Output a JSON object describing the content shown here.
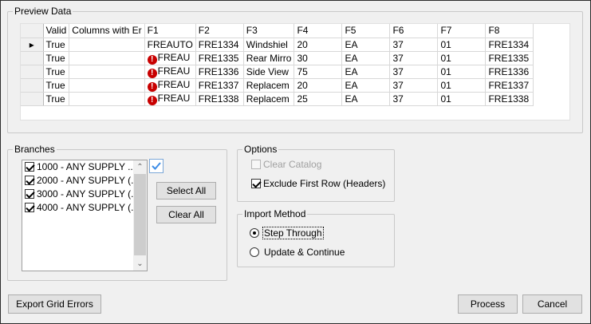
{
  "preview": {
    "legend": "Preview Data",
    "columns": [
      "Valid",
      "Columns with Er",
      "F1",
      "F2",
      "F3",
      "F4",
      "F5",
      "F6",
      "F7",
      "F8"
    ],
    "rows": [
      {
        "current": true,
        "valid": "True",
        "errors": "",
        "f1": "FREAUTO",
        "f1_error": false,
        "f2": "FRE1334",
        "f3": "Windshiel",
        "f4": "20",
        "f5": "EA",
        "f6": "37",
        "f7": "01",
        "f8": "FRE1334"
      },
      {
        "current": false,
        "valid": "True",
        "errors": "",
        "f1": "FREAU",
        "f1_error": true,
        "f2": "FRE1335",
        "f3": "Rear Mirro",
        "f4": "30",
        "f5": "EA",
        "f6": "37",
        "f7": "01",
        "f8": "FRE1335"
      },
      {
        "current": false,
        "valid": "True",
        "errors": "",
        "f1": "FREAU",
        "f1_error": true,
        "f2": "FRE1336",
        "f3": "Side View",
        "f4": "75",
        "f5": "EA",
        "f6": "37",
        "f7": "01",
        "f8": "FRE1336"
      },
      {
        "current": false,
        "valid": "True",
        "errors": "",
        "f1": "FREAU",
        "f1_error": true,
        "f2": "FRE1337",
        "f3": "Replacem",
        "f4": "20",
        "f5": "EA",
        "f6": "37",
        "f7": "01",
        "f8": "FRE1337"
      },
      {
        "current": false,
        "valid": "True",
        "errors": "",
        "f1": "FREAU",
        "f1_error": true,
        "f2": "FRE1338",
        "f3": "Replacem",
        "f4": "25",
        "f5": "EA",
        "f6": "37",
        "f7": "01",
        "f8": "FRE1338"
      }
    ]
  },
  "branches": {
    "legend": "Branches",
    "items": [
      {
        "label": "1000 - ANY SUPPLY ...",
        "checked": true
      },
      {
        "label": "2000 - ANY SUPPLY (...",
        "checked": true
      },
      {
        "label": "3000 - ANY SUPPLY (...",
        "checked": true
      },
      {
        "label": "4000 - ANY SUPPLY (...",
        "checked": true
      }
    ],
    "select_all_label": "Select All",
    "clear_all_label": "Clear All",
    "check_icon": "checkmark-icon",
    "check_color": "#3c8ce6"
  },
  "options": {
    "legend": "Options",
    "clear_catalog_label": "Clear Catalog",
    "clear_catalog_checked": false,
    "clear_catalog_disabled": true,
    "exclude_first_row_label": "Exclude First Row (Headers)",
    "exclude_first_row_checked": true
  },
  "import_method": {
    "legend": "Import Method",
    "choices": [
      {
        "label": "Step Through",
        "selected": true
      },
      {
        "label": "Update & Continue",
        "selected": false
      }
    ]
  },
  "footer": {
    "export_label": "Export Grid Errors",
    "process_label": "Process",
    "cancel_label": "Cancel"
  },
  "colors": {
    "window_bg": "#f0f0f0",
    "error_icon": "#c80000",
    "button_bg": "#e1e1e1"
  }
}
